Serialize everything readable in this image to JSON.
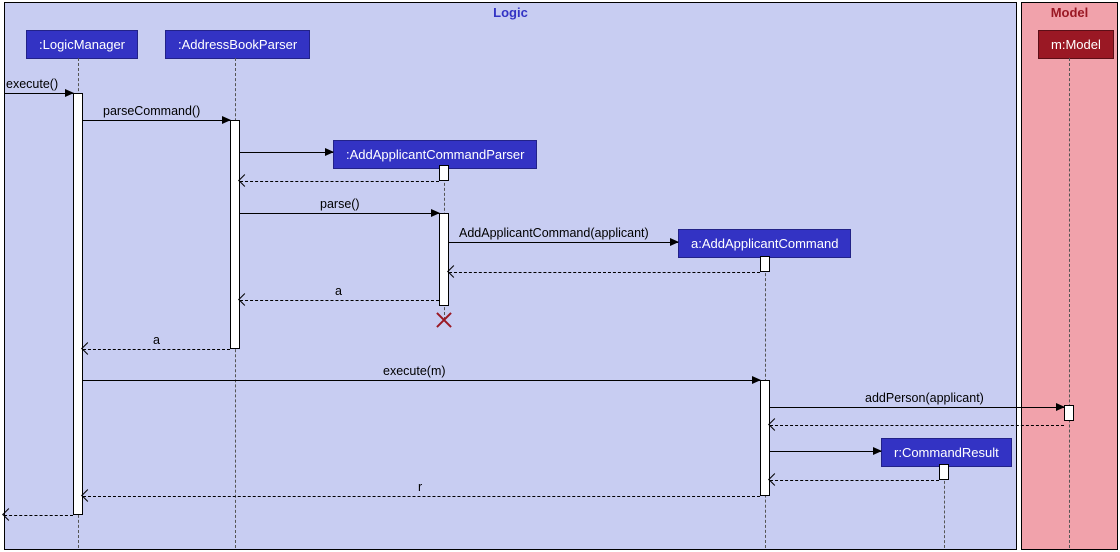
{
  "regions": {
    "logic": "Logic",
    "model": "Model"
  },
  "participants": {
    "logicManager": ":LogicManager",
    "addressBookParser": ":AddressBookParser",
    "addApplicantCommandParser": ":AddApplicantCommandParser",
    "addApplicantCommand": "a:AddApplicantCommand",
    "commandResult": "r:CommandResult",
    "model": "m:Model"
  },
  "messages": {
    "m1": "execute()",
    "m2": "parseCommand()",
    "m3_return": "",
    "m4": "parse()",
    "m5": "AddApplicantCommand(applicant)",
    "m6_return": "",
    "m7_return": "a",
    "m8_return": "a",
    "m9": "execute(m)",
    "m10": "addPerson(applicant)",
    "m11_return": "",
    "m12_create_cr": "",
    "m13_return": "",
    "m14_return": "r"
  },
  "chart_data": {
    "type": "sequence-diagram",
    "regions": [
      {
        "name": "Logic",
        "participants": [
          "LogicManager",
          "AddressBookParser",
          "AddApplicantCommandParser",
          "AddApplicantCommand",
          "CommandResult"
        ]
      },
      {
        "name": "Model",
        "participants": [
          "Model"
        ]
      }
    ],
    "participants": [
      {
        "id": "LogicManager",
        "label": ":LogicManager"
      },
      {
        "id": "AddressBookParser",
        "label": ":AddressBookParser"
      },
      {
        "id": "AddApplicantCommandParser",
        "label": ":AddApplicantCommandParser",
        "created_by": "AddressBookParser",
        "destroyed": true
      },
      {
        "id": "AddApplicantCommand",
        "label": "a:AddApplicantCommand",
        "created_by": "AddApplicantCommandParser"
      },
      {
        "id": "CommandResult",
        "label": "r:CommandResult",
        "created_by": "AddApplicantCommand"
      },
      {
        "id": "Model",
        "label": "m:Model"
      }
    ],
    "messages": [
      {
        "from": "external",
        "to": "LogicManager",
        "label": "execute()",
        "type": "sync"
      },
      {
        "from": "LogicManager",
        "to": "AddressBookParser",
        "label": "parseCommand()",
        "type": "sync"
      },
      {
        "from": "AddressBookParser",
        "to": "AddApplicantCommandParser",
        "label": "",
        "type": "create"
      },
      {
        "from": "AddApplicantCommandParser",
        "to": "AddressBookParser",
        "label": "",
        "type": "return"
      },
      {
        "from": "AddressBookParser",
        "to": "AddApplicantCommandParser",
        "label": "parse()",
        "type": "sync"
      },
      {
        "from": "AddApplicantCommandParser",
        "to": "AddApplicantCommand",
        "label": "AddApplicantCommand(applicant)",
        "type": "create"
      },
      {
        "from": "AddApplicantCommand",
        "to": "AddApplicantCommandParser",
        "label": "",
        "type": "return"
      },
      {
        "from": "AddApplicantCommandParser",
        "to": "AddressBookParser",
        "label": "a",
        "type": "return"
      },
      {
        "from": "AddApplicantCommandParser",
        "to": null,
        "label": "",
        "type": "destroy"
      },
      {
        "from": "AddressBookParser",
        "to": "LogicManager",
        "label": "a",
        "type": "return"
      },
      {
        "from": "LogicManager",
        "to": "AddApplicantCommand",
        "label": "execute(m)",
        "type": "sync"
      },
      {
        "from": "AddApplicantCommand",
        "to": "Model",
        "label": "addPerson(applicant)",
        "type": "sync"
      },
      {
        "from": "Model",
        "to": "AddApplicantCommand",
        "label": "",
        "type": "return"
      },
      {
        "from": "AddApplicantCommand",
        "to": "CommandResult",
        "label": "",
        "type": "create"
      },
      {
        "from": "CommandResult",
        "to": "AddApplicantCommand",
        "label": "",
        "type": "return"
      },
      {
        "from": "AddApplicantCommand",
        "to": "LogicManager",
        "label": "r",
        "type": "return"
      },
      {
        "from": "LogicManager",
        "to": "external",
        "label": "",
        "type": "return"
      }
    ]
  }
}
